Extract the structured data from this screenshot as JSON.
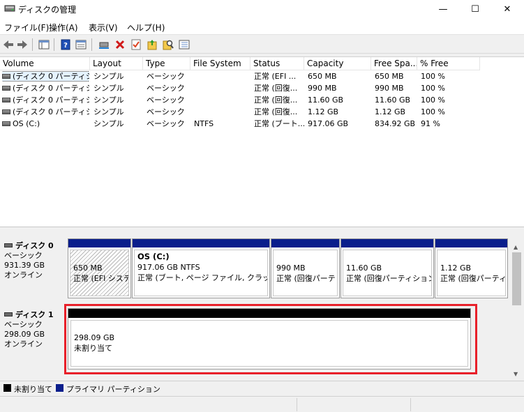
{
  "window": {
    "title": "ディスクの管理",
    "controls": {
      "minimize": "—",
      "maximize": "☐",
      "close": "✕"
    }
  },
  "menu": [
    "ファイル(F)",
    "操作(A)",
    "表示(V)",
    "ヘルプ(H)"
  ],
  "toolbar": [
    "back-icon",
    "forward-icon",
    "console-tree-icon",
    "help-icon",
    "properties-icon",
    "connect-icon",
    "delete-icon",
    "check-icon",
    "export-icon",
    "search-icon",
    "list-icon"
  ],
  "columns": [
    "Volume",
    "Layout",
    "Type",
    "File System",
    "Status",
    "Capacity",
    "Free Spa...",
    "% Free"
  ],
  "volumes": [
    {
      "volume": "(ディスク 0 パーティシ...",
      "layout": "シンプル",
      "type": "ベーシック",
      "fs": "",
      "status": "正常 (EFI ...",
      "capacity": "650 MB",
      "free": "650 MB",
      "pct": "100 %"
    },
    {
      "volume": "(ディスク 0 パーティシ...",
      "layout": "シンプル",
      "type": "ベーシック",
      "fs": "",
      "status": "正常 (回復...",
      "capacity": "990 MB",
      "free": "990 MB",
      "pct": "100 %"
    },
    {
      "volume": "(ディスク 0 パーティシ...",
      "layout": "シンプル",
      "type": "ベーシック",
      "fs": "",
      "status": "正常 (回復...",
      "capacity": "11.60 GB",
      "free": "11.60 GB",
      "pct": "100 %"
    },
    {
      "volume": "(ディスク 0 パーティシ...",
      "layout": "シンプル",
      "type": "ベーシック",
      "fs": "",
      "status": "正常 (回復...",
      "capacity": "1.12 GB",
      "free": "1.12 GB",
      "pct": "100 %"
    },
    {
      "volume": "OS (C:)",
      "layout": "シンプル",
      "type": "ベーシック",
      "fs": "NTFS",
      "status": "正常 (ブート...",
      "capacity": "917.06 GB",
      "free": "834.92 GB",
      "pct": "91 %"
    }
  ],
  "disk0": {
    "name": "ディスク 0",
    "type": "ベーシック",
    "size": "931.39 GB",
    "state": "オンライン",
    "partitions": [
      {
        "name": "",
        "line1": "650 MB",
        "line2": "正常 (EFI システ"
      },
      {
        "name": "OS  (C:)",
        "line1": "917.06 GB NTFS",
        "line2": "正常 (ブート, ページ ファイル, クラッシュ ダ"
      },
      {
        "name": "",
        "line1": "990 MB",
        "line2": "正常 (回復パーテ"
      },
      {
        "name": "",
        "line1": "11.60 GB",
        "line2": "正常 (回復パーティション)"
      },
      {
        "name": "",
        "line1": "1.12 GB",
        "line2": "正常 (回復パーティ"
      }
    ]
  },
  "disk1": {
    "name": "ディスク 1",
    "type": "ベーシック",
    "size": "298.09 GB",
    "state": "オンライン",
    "unallocated": {
      "size": "298.09 GB",
      "label": "未割り当て"
    }
  },
  "legend": [
    {
      "label": "未割り当て",
      "color": "#000000"
    },
    {
      "label": "プライマリ パーティション",
      "color": "#0a1e8c"
    }
  ]
}
